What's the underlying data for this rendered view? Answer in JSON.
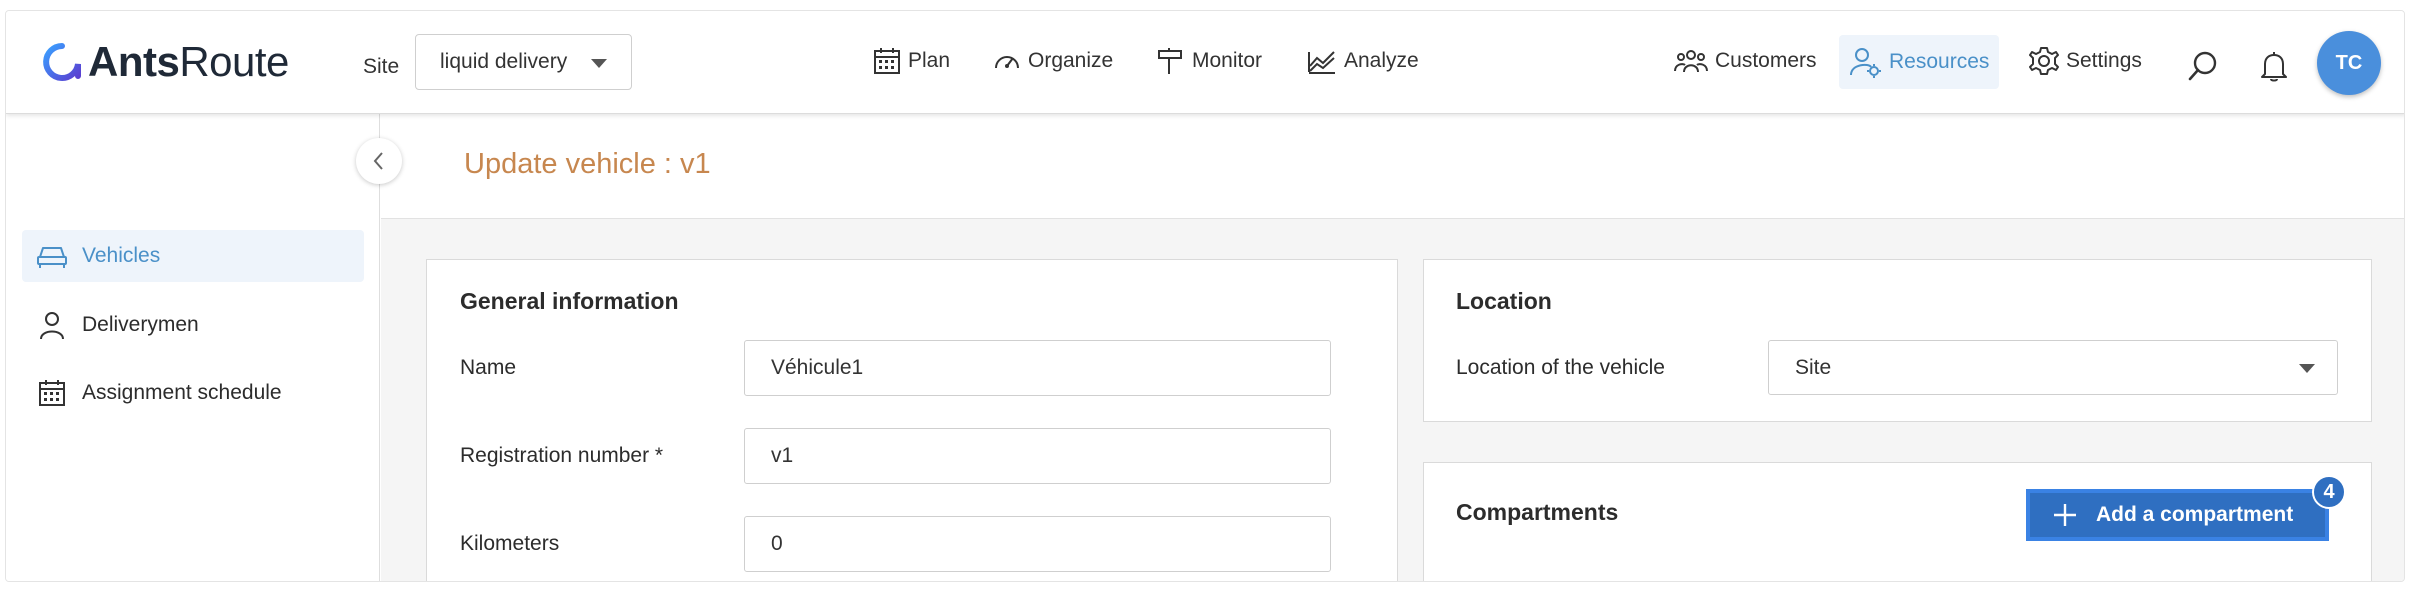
{
  "header": {
    "logo": {
      "bold": "Ants",
      "light": "Route"
    },
    "site_label": "Site",
    "site_value": "liquid delivery",
    "nav": {
      "plan": "Plan",
      "organize": "Organize",
      "monitor": "Monitor",
      "analyze": "Analyze"
    },
    "right_nav": {
      "customers": "Customers",
      "resources": "Resources",
      "settings": "Settings"
    },
    "avatar_initials": "TC"
  },
  "sidebar": {
    "items": [
      {
        "label": "Vehicles",
        "icon": "car-icon",
        "active": true
      },
      {
        "label": "Deliverymen",
        "icon": "person-icon",
        "active": false
      },
      {
        "label": "Assignment schedule",
        "icon": "calendar-icon",
        "active": false
      }
    ]
  },
  "page": {
    "title": "Update vehicle : v1"
  },
  "general": {
    "title": "General information",
    "name_label": "Name",
    "name_value": "Véhicule1",
    "registration_label": "Registration number *",
    "registration_value": "v1",
    "kilometers_label": "Kilometers",
    "kilometers_value": "0"
  },
  "location": {
    "title": "Location",
    "label": "Location of the vehicle",
    "value": "Site"
  },
  "compartments": {
    "title": "Compartments",
    "add_button": "Add a compartment",
    "badge": "4"
  },
  "colors": {
    "accent": "#4a90c8",
    "title": "#c7874f",
    "button": "#2f6fc1"
  }
}
